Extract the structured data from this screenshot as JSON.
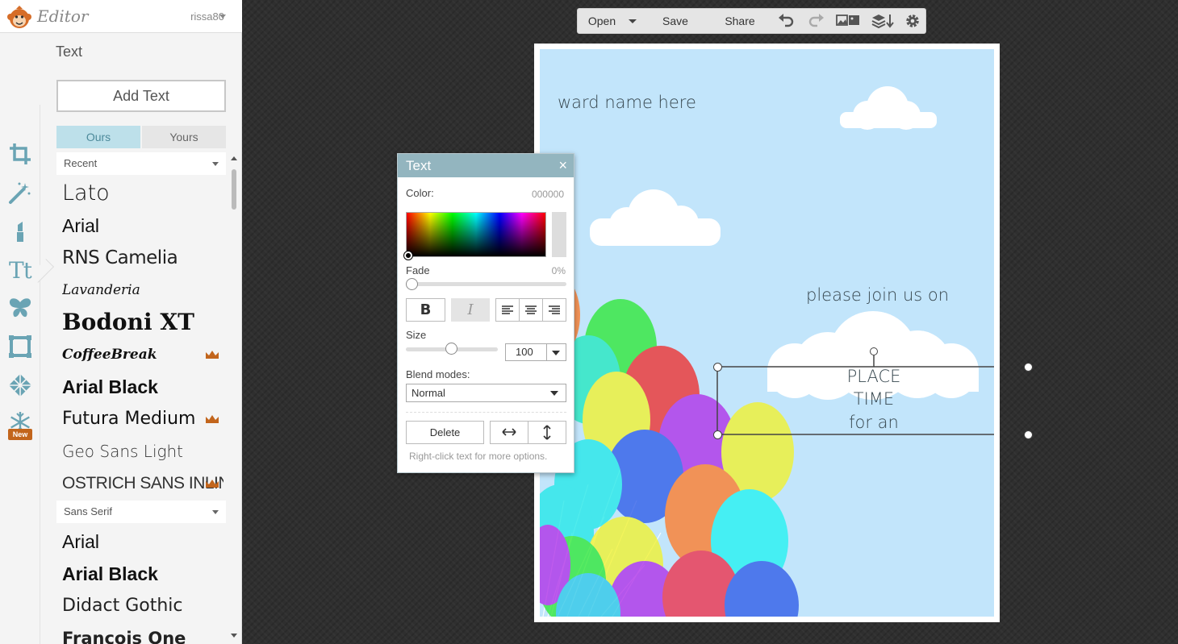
{
  "header": {
    "app_title": "Editor",
    "username": "rissa80"
  },
  "panel": {
    "heading": "Text",
    "add_text_label": "Add Text",
    "tabs": {
      "ours": "Ours",
      "yours": "Yours"
    },
    "categories": {
      "recent": "Recent",
      "sans_serif": "Sans Serif"
    },
    "recent_fonts": [
      "Lato",
      "Arial",
      "RNS Camelia",
      "Lavanderia",
      "Bodoni XT",
      "CoffeeBreak",
      "Arial Black",
      "Futura Medium",
      "Geo Sans Light",
      "OSTRICH SANS INLINE"
    ],
    "sans_serif_fonts": [
      "Arial",
      "Arial Black",
      "Didact Gothic",
      "Francois One"
    ],
    "tool_text_glyph": "Tt",
    "new_badge": "New"
  },
  "toolbar": {
    "open": "Open",
    "save": "Save",
    "share": "Share"
  },
  "canvas": {
    "texts": {
      "award": "ward name here",
      "join": "please join us on",
      "place": "PLACE",
      "time": "TIME",
      "for_an": "for an"
    },
    "background_color": "#c2e5fb"
  },
  "dialog": {
    "title": "Text",
    "close": "×",
    "color_label": "Color:",
    "color_value": "000000",
    "fade_label": "Fade",
    "fade_value": "0%",
    "bold": "B",
    "italic": "I",
    "size_label": "Size",
    "size_value": "100",
    "blend_label": "Blend modes:",
    "blend_value": "Normal",
    "delete_label": "Delete",
    "hint": "Right-click text for more options."
  },
  "colors": {
    "accent": "#93b5bf",
    "tab_active": "#bde0ea",
    "brand_orange": "#c2651c"
  }
}
